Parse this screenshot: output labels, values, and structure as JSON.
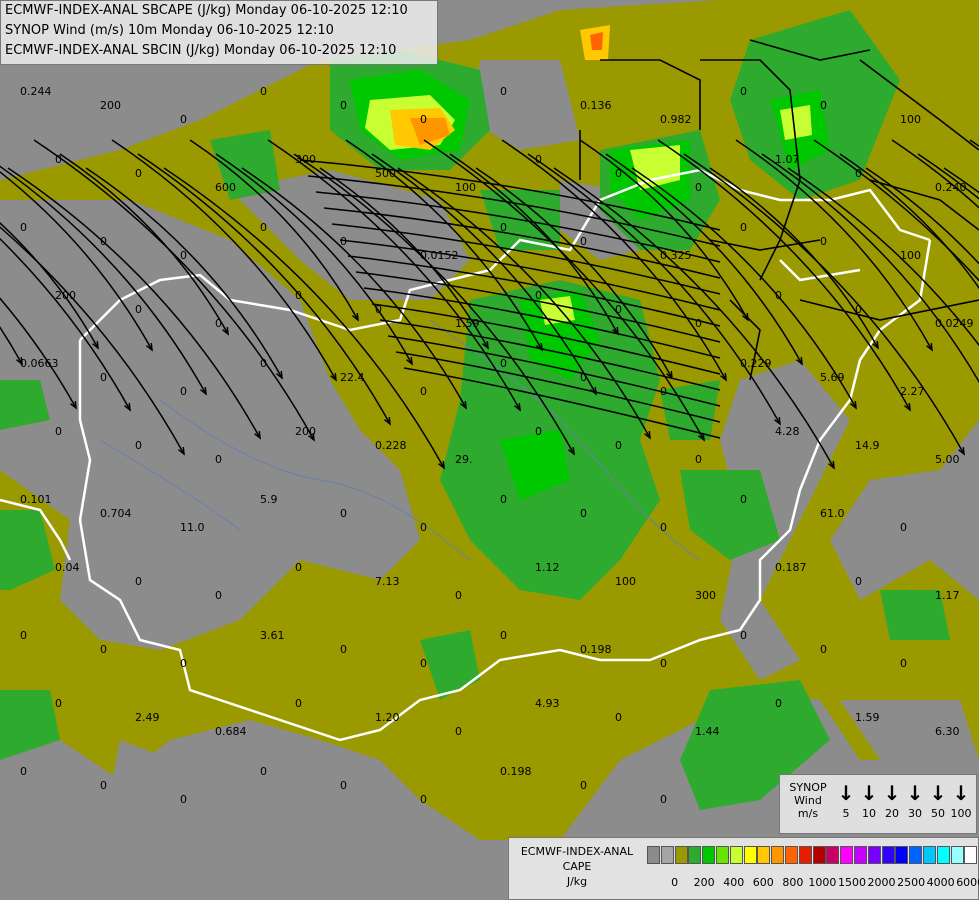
{
  "titles": {
    "line1": "ECMWF-INDEX-ANAL SBCAPE (J/kg) Monday 06-10-2025 12:10",
    "line2": "SYNOP Wind (m/s) 10m Monday 06-10-2025 12:10",
    "line3": "ECMWF-INDEX-ANAL SBCIN (J/kg) Monday 06-10-2025 12:10"
  },
  "synop_legend": {
    "title_line1": "SYNOP",
    "title_line2": "Wind",
    "title_line3": "m/s",
    "speeds": [
      "5",
      "10",
      "20",
      "30",
      "50",
      "100"
    ]
  },
  "cape_legend": {
    "title_line1": "ECMWF-INDEX-ANAL",
    "title_line2": "CAPE",
    "title_line3": "J/kg",
    "labels": [
      "0",
      "200",
      "400",
      "600",
      "800",
      "1000",
      "1500",
      "2000",
      "2500",
      "4000",
      "6000"
    ],
    "colors": [
      "#8c8c8c",
      "#a5a5a5",
      "#9a9a00",
      "#2eaa2e",
      "#00c800",
      "#64e600",
      "#c8ff32",
      "#ffff00",
      "#ffc800",
      "#ff9600",
      "#ff6400",
      "#e61e00",
      "#b40000",
      "#c80064",
      "#ff00ff",
      "#c800ff",
      "#7800ff",
      "#3200ff",
      "#0000ff",
      "#0064ff",
      "#00c8ff",
      "#00ffff",
      "#96ffff",
      "#ffffff"
    ]
  },
  "map_labels": [
    "0.244",
    "200",
    "0",
    "0",
    "0",
    "0",
    "0",
    "0.136",
    "0.982",
    "0",
    "0",
    "100",
    "0",
    "0",
    "600",
    "300",
    "500",
    "100",
    "0",
    "0",
    "0",
    "1.07",
    "0",
    "0.240",
    "0",
    "0",
    "0",
    "0",
    "0",
    "0.0152",
    "0",
    "0",
    "0.325",
    "0",
    "0",
    "100",
    "200",
    "0",
    "0",
    "0",
    "0",
    "1.59",
    "0",
    "0",
    "0",
    "0",
    "0",
    "0.0249",
    "0.0663",
    "0",
    "0",
    "0",
    "22.4",
    "0",
    "0",
    "0",
    "0",
    "0.229",
    "5.69",
    "2.27",
    "0",
    "0",
    "0",
    "200",
    "0.228",
    "29.",
    "0",
    "0",
    "0",
    "4.28",
    "14.9",
    "5.00",
    "0.101",
    "0.704",
    "11.0",
    "5.9",
    "0",
    "0",
    "0",
    "0",
    "0",
    "0",
    "61.0",
    "0",
    "0.04",
    "0",
    "0",
    "0",
    "7.13",
    "0",
    "1.12",
    "100",
    "300",
    "0.187",
    "0",
    "1.17",
    "0",
    "0",
    "0",
    "3.61",
    "0",
    "0",
    "0",
    "0.198",
    "0",
    "0",
    "0",
    "0",
    "0",
    "2.49",
    "0.684",
    "0",
    "1.20",
    "0",
    "4.93",
    "0",
    "1.44",
    "0",
    "1.59",
    "6.30",
    "0",
    "0",
    "0",
    "0",
    "0",
    "0",
    "0.198",
    "0",
    "0"
  ]
}
